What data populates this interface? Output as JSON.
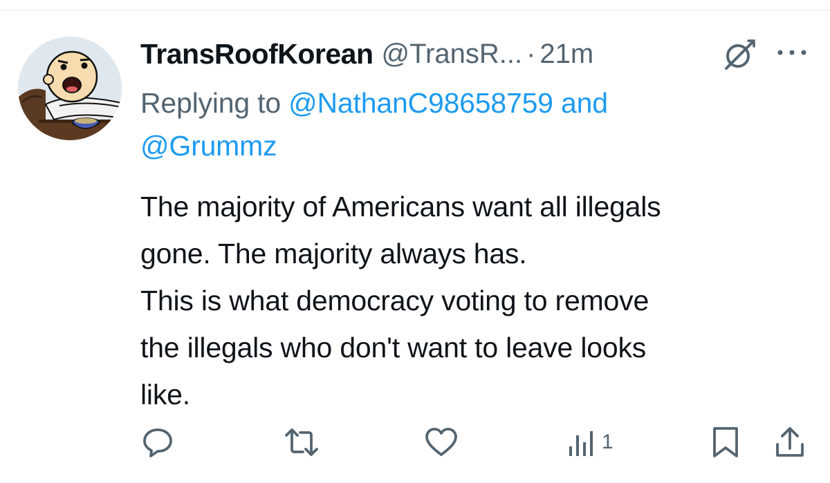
{
  "tweet": {
    "display_name": "TransRoofKorean",
    "handle": "@TransR...",
    "separator": "·",
    "time": "21m",
    "replying_prefix": "Replying to ",
    "reply_mention_1": "@NathanC98658759",
    "reply_and": " and",
    "reply_mention_2": "@Grummz",
    "text": "The majority of Americans want all illegals\ngone. The majority always has.\nThis is what democracy voting to remove\nthe illegals who don't want to leave looks\nlike."
  },
  "actions": {
    "reply_icon": "reply-icon",
    "retweet_icon": "retweet-icon",
    "like_icon": "heart-icon",
    "views_icon": "views-icon",
    "views_count": "1",
    "bookmark_icon": "bookmark-icon",
    "share_icon": "share-icon"
  },
  "header_icons": {
    "grok": "grok-icon",
    "more": "more-icon"
  },
  "colors": {
    "text_primary": "#0f1419",
    "text_secondary": "#536471",
    "mention": "#1d9bf0",
    "background": "#ffffff"
  }
}
